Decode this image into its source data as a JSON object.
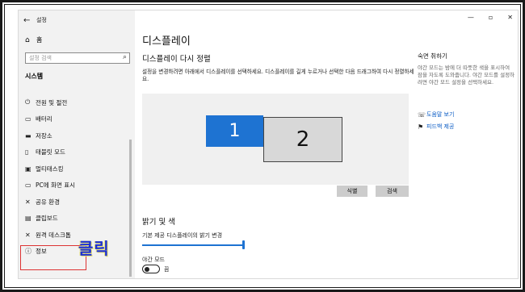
{
  "window": {
    "title": "설정",
    "back_icon": "←"
  },
  "controls": {
    "minimize": "—",
    "maximize": "▫",
    "close": "✕"
  },
  "sidebar": {
    "home_label": "홈",
    "search_placeholder": "설정 검색",
    "section_title": "시스템",
    "items": [
      {
        "icon": "power-icon",
        "glyph": "⏻",
        "label": "전원 및 절전"
      },
      {
        "icon": "battery-icon",
        "glyph": "▭",
        "label": "배터리"
      },
      {
        "icon": "storage-icon",
        "glyph": "▬",
        "label": "저장소"
      },
      {
        "icon": "tablet-icon",
        "glyph": "▯",
        "label": "태블릿 모드"
      },
      {
        "icon": "multitasking-icon",
        "glyph": "▣",
        "label": "멀티태스킹"
      },
      {
        "icon": "projecting-icon",
        "glyph": "▭",
        "label": "PC에 화면 표시"
      },
      {
        "icon": "shared-experiences-icon",
        "glyph": "✕",
        "label": "공유 환경"
      },
      {
        "icon": "clipboard-icon",
        "glyph": "▤",
        "label": "클립보드"
      },
      {
        "icon": "remote-desktop-icon",
        "glyph": "✕",
        "label": "원격 데스크톱"
      },
      {
        "icon": "about-icon",
        "glyph": "ⓘ",
        "label": "정보"
      }
    ]
  },
  "annotation": {
    "click_label": "클릭"
  },
  "main": {
    "page_title": "디스플레이",
    "rearrange_title": "디스플레이 다시 정렬",
    "rearrange_desc": "설정을 변경하려면 아래에서 디스플레이를 선택하세요. 디스플레이를 길게 누르거나 선택한 다음 드래그하여 다시 정렬하세요.",
    "monitors": [
      "1",
      "2"
    ],
    "identify_label": "식별",
    "detect_label": "검색",
    "brightness_title": "밝기 및 색",
    "brightness_label": "기본 제공 디스플레이의 밝기 변경",
    "brightness_value": 100,
    "night_light_label": "야간 모드",
    "night_light_state": "끔"
  },
  "right": {
    "title": "숙면 취하기",
    "desc": "야간 모드는 밤에 더 따뜻한 색을 표시하여 잠을 자도록 도와줍니다. 야간 모드를 설정하려면 야간 모드 설정을 선택하세요.",
    "help_label": "도움말 보기",
    "feedback_label": "피드백 제공"
  },
  "colors": {
    "accent": "#1e73d2",
    "annotation": "#1c2fd6",
    "highlight": "#dd3333"
  }
}
